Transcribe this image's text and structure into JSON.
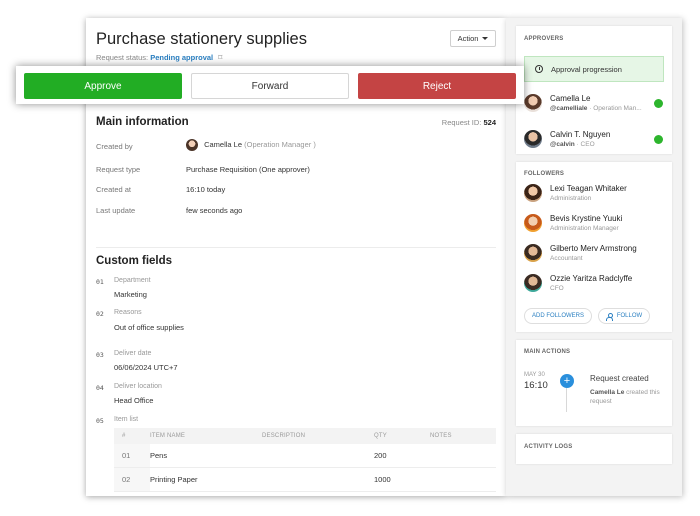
{
  "header": {
    "title": "Purchase stationery supplies",
    "status_label": "Request status:",
    "status_value": "Pending approval",
    "action_label": "Action"
  },
  "buttons": {
    "approve": "Approve",
    "forward": "Forward",
    "reject": "Reject"
  },
  "main_info": {
    "title": "Main information",
    "request_id_label": "Request ID:",
    "request_id": "524",
    "rows": {
      "created_by_label": "Created by",
      "created_by_name": "Camella Le",
      "created_by_role": "(Operation Manager )",
      "request_type_label": "Request type",
      "request_type_value": "Purchase Requisition  (One approver)",
      "created_at_label": "Created at",
      "created_at_value": "16:10 today",
      "last_update_label": "Last update",
      "last_update_value": "few seconds ago"
    }
  },
  "custom_fields": {
    "title": "Custom fields",
    "fields": [
      {
        "num": "01",
        "label": "Department",
        "value": "Marketing"
      },
      {
        "num": "02",
        "label": "Reasons",
        "value": "Out of office supplies"
      },
      {
        "num": "03",
        "label": "Deliver date",
        "value": "06/06/2024 UTC+7"
      },
      {
        "num": "04",
        "label": "Deliver location",
        "value": "Head Office"
      },
      {
        "num": "05",
        "label": "Item list",
        "value": ""
      }
    ],
    "item_table": {
      "headers": [
        "#",
        "ITEM NAME",
        "DESCRIPTION",
        "QTY",
        "NOTES"
      ],
      "rows": [
        {
          "num": "01",
          "name": "Pens",
          "description": "",
          "qty": "200",
          "notes": ""
        },
        {
          "num": "02",
          "name": "Printing Paper",
          "description": "",
          "qty": "1000",
          "notes": ""
        }
      ]
    }
  },
  "approvers": {
    "title": "APPROVERS",
    "progression_label": "Approval progression",
    "people": [
      {
        "name": "Camella Le",
        "handle": "@camelliale",
        "role": "· Operation Man...",
        "color": "#2db52d"
      },
      {
        "name": "Calvin T. Nguyen",
        "handle": "@calvin",
        "role": "· CEO",
        "color": "#2db52d"
      }
    ]
  },
  "followers": {
    "title": "FOLLOWERS",
    "people": [
      {
        "name": "Lexi Teagan Whitaker",
        "role": "Administration"
      },
      {
        "name": "Bevis Krystine Yuuki",
        "role": "Administration Manager"
      },
      {
        "name": "Gilberto Merv Armstrong",
        "role": "Accountant"
      },
      {
        "name": "Ozzie Yaritza Radclyffe",
        "role": "CFO"
      }
    ],
    "add_label": "ADD FOLLOWERS",
    "follow_label": "FOLLOW"
  },
  "main_actions": {
    "title": "MAIN ACTIONS",
    "date": "MAY 30",
    "time": "16:10",
    "event": "Request created",
    "actor": "Camella Le",
    "desc": "created this request"
  },
  "activity_logs": {
    "title": "ACTIVITY LOGS"
  },
  "colors": {
    "approve": "#22ad24",
    "reject": "#c44444",
    "link": "#2a7fc1",
    "status_ok": "#2db52d"
  }
}
